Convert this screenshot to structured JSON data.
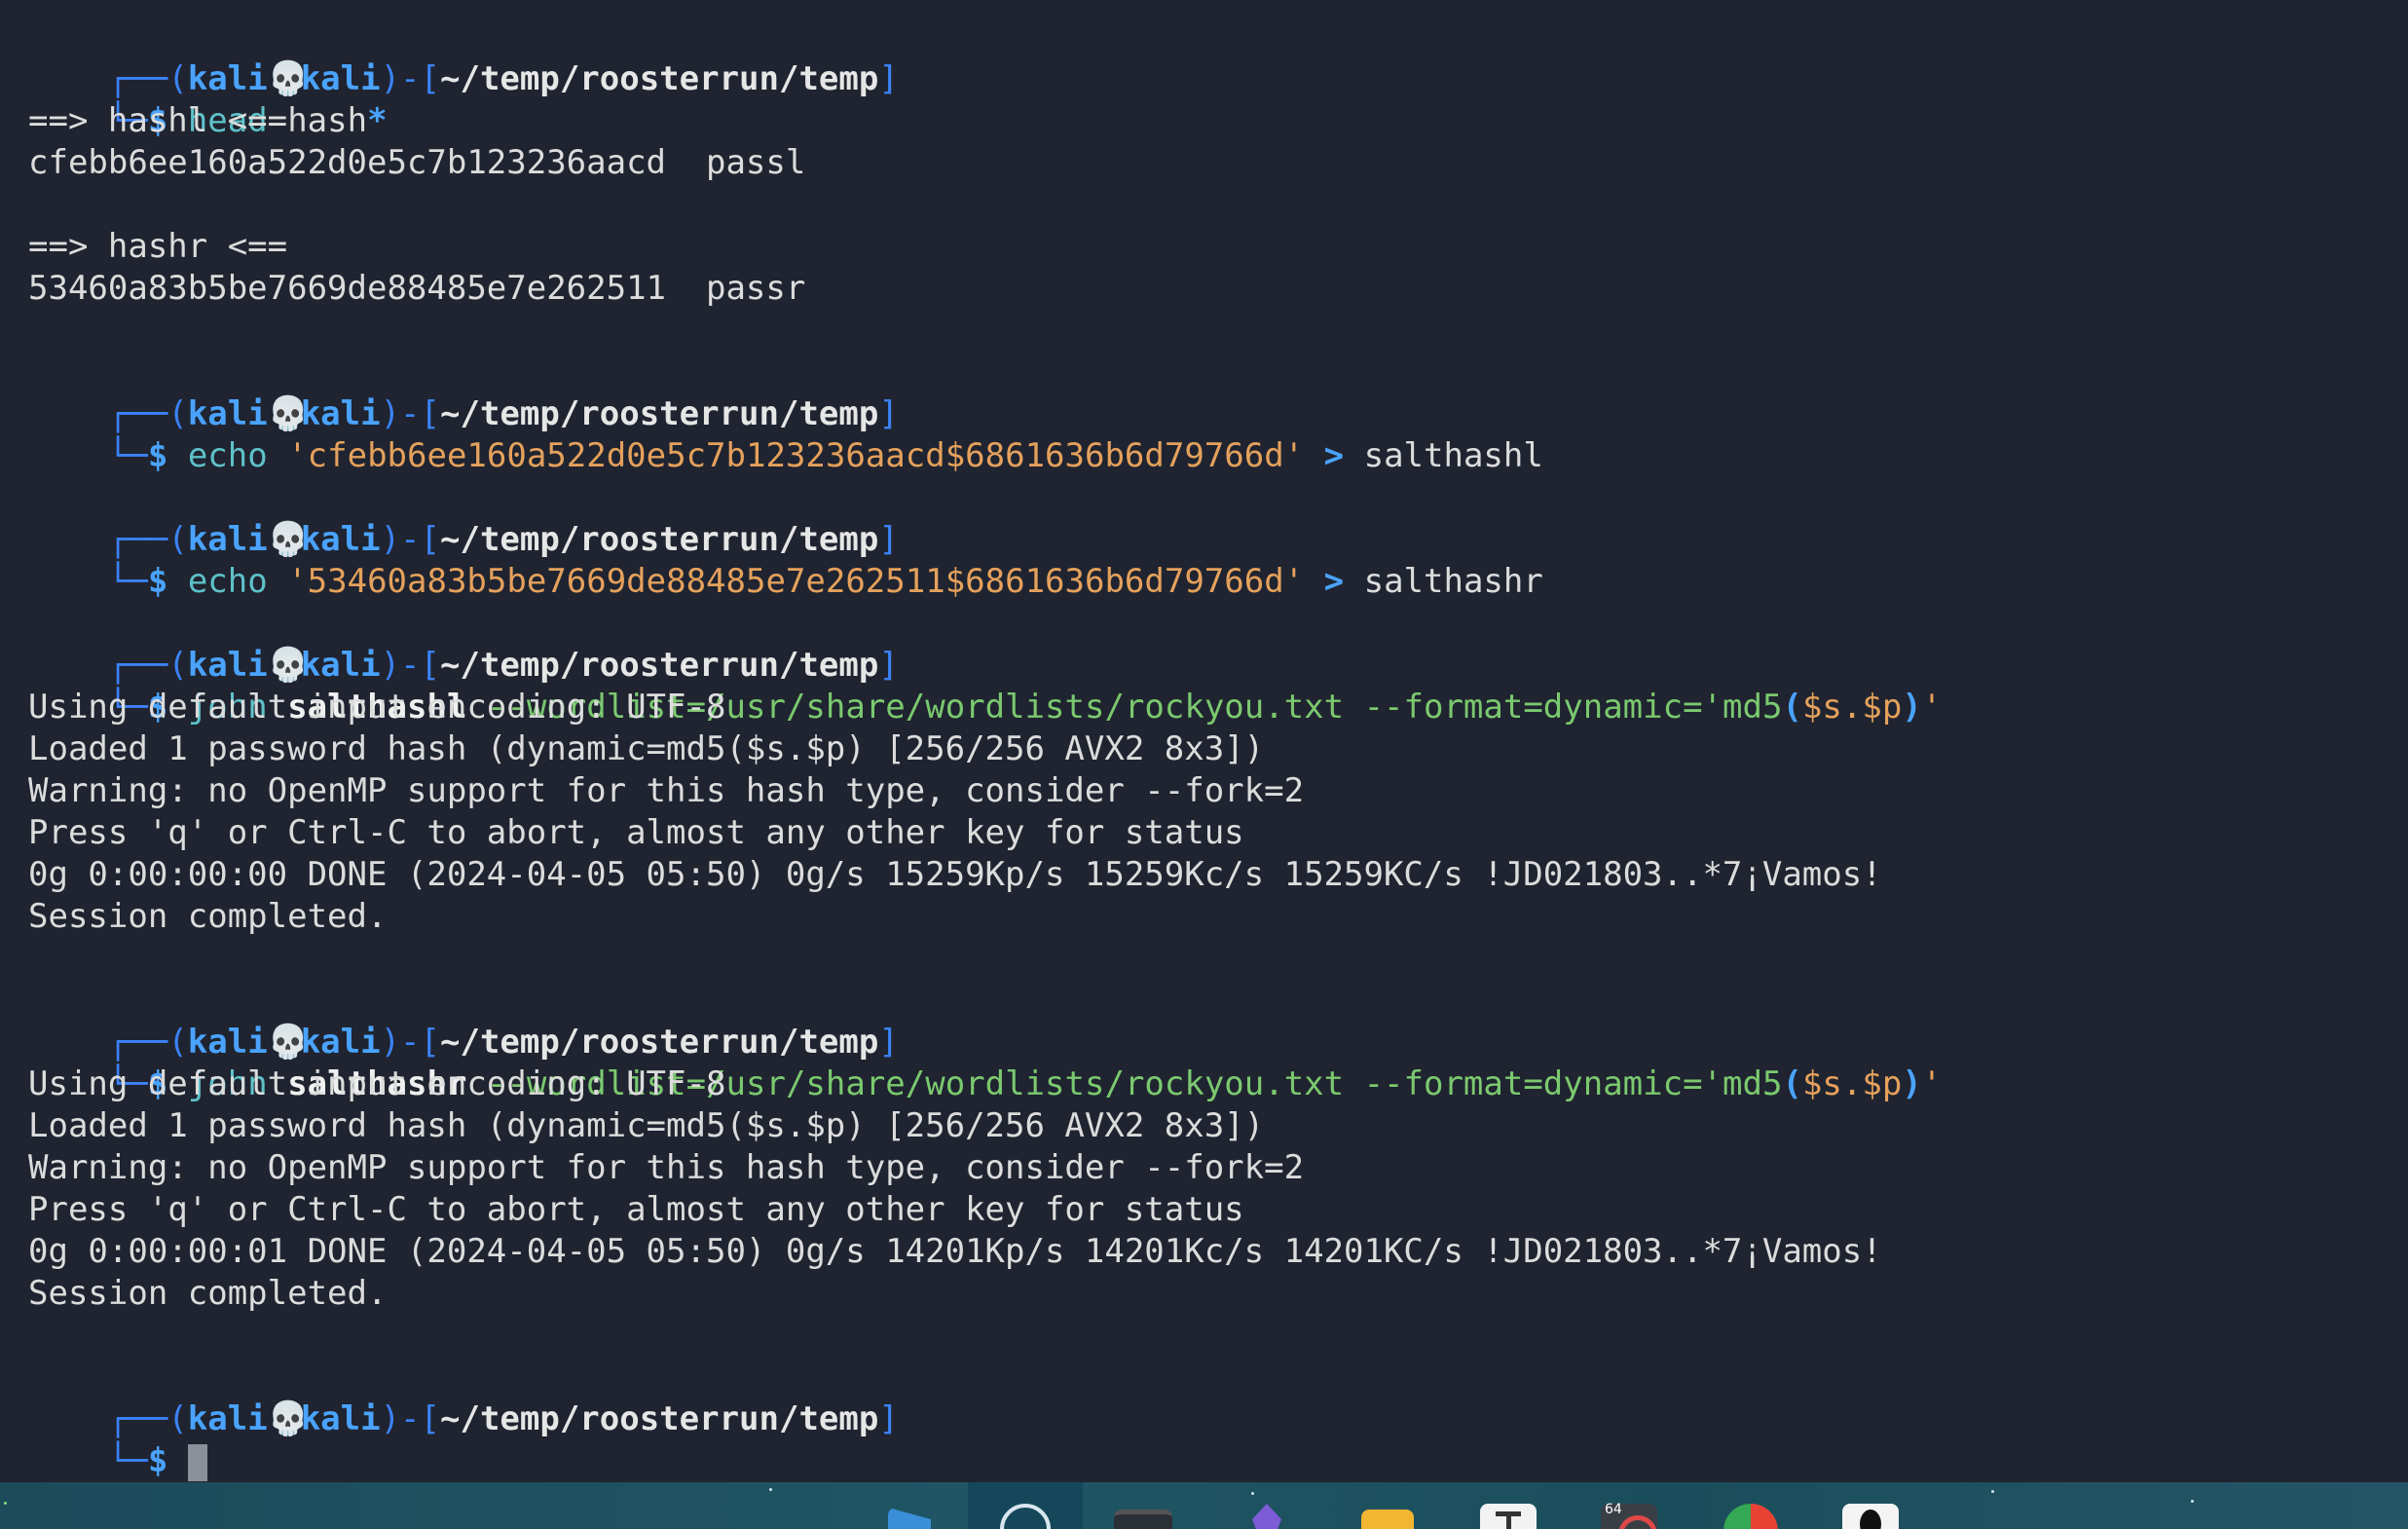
{
  "prompt": {
    "bar_top": "┌──",
    "bar_bottom": "└─",
    "open": "(",
    "user": "kali",
    "skull": "💀",
    "host": "kali",
    "close_dash": ")-[",
    "path": "~/temp/roosterrun/temp",
    "close_bracket": "]",
    "dollar": "$"
  },
  "blocks": [
    {
      "cmd": "head",
      "args": "hash",
      "star": "*"
    },
    {
      "out": "==> hashl <=="
    },
    {
      "out": "cfebb6ee160a522d0e5c7b123236aacd  passl"
    },
    {
      "out": "==> hashr <=="
    },
    {
      "out": "53460a83b5be7669de88485e7e262511  passr"
    }
  ],
  "echo1": {
    "cmd": "echo",
    "str": "'cfebb6ee160a522d0e5c7b123236aacd$6861636b6d79766d'",
    "op": ">",
    "file": "salthashl"
  },
  "echo2": {
    "cmd": "echo",
    "str": "'53460a83b5be7669de88485e7e262511$6861636b6d79766d'",
    "op": ">",
    "file": "salthashr"
  },
  "john1": {
    "cmd": "john",
    "file": "salthashl",
    "opts": "--wordlist=/usr/share/wordlists/rockyou.txt --format=dynamic='md5",
    "po": "(",
    "inner": "$s.$p",
    "pc": ")",
    "q": "'"
  },
  "john1_out": [
    "Using default input encoding: UTF-8",
    "Loaded 1 password hash (dynamic=md5($s.$p) [256/256 AVX2 8x3])",
    "Warning: no OpenMP support for this hash type, consider --fork=2",
    "Press 'q' or Ctrl-C to abort, almost any other key for status",
    "0g 0:00:00:00 DONE (2024-04-05 05:50) 0g/s 15259Kp/s 15259Kc/s 15259KC/s !JD021803..*7¡Vamos!",
    "Session completed."
  ],
  "john2": {
    "cmd": "john",
    "file": "salthashr",
    "opts": "--wordlist=/usr/share/wordlists/rockyou.txt --format=dynamic='md5",
    "po": "(",
    "inner": "$s.$p",
    "pc": ")",
    "q": "'"
  },
  "john2_out": [
    "Using default input encoding: UTF-8",
    "Loaded 1 password hash (dynamic=md5($s.$p) [256/256 AVX2 8x3])",
    "Warning: no OpenMP support for this hash type, consider --fork=2",
    "Press 'q' or Ctrl-C to abort, almost any other key for status",
    "0g 0:00:00:01 DONE (2024-04-05 05:50) 0g/s 14201Kp/s 14201Kc/s 14201KC/s !JD021803..*7¡Vamos!",
    "Session completed."
  ],
  "taskbar": {
    "icons": [
      "files-flag-icon",
      "app-circle-icon",
      "terminal-icon",
      "obsidian-icon",
      "folder-icon",
      "typora-icon",
      "app-64-icon",
      "chrome-icon",
      "qq-icon"
    ],
    "badge": "64"
  }
}
